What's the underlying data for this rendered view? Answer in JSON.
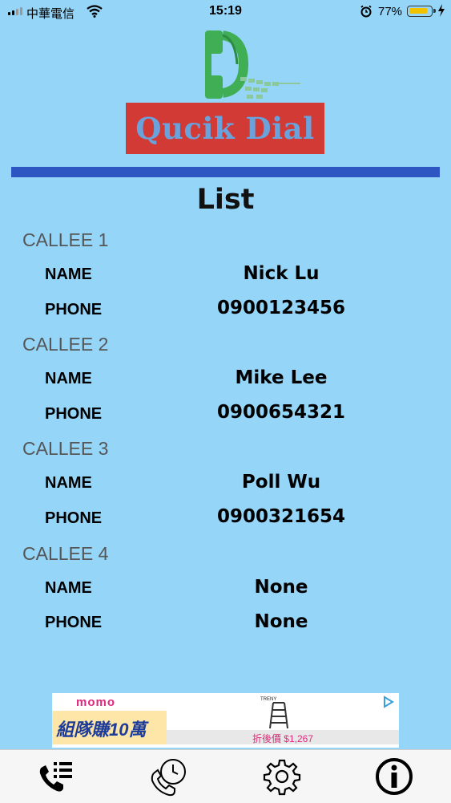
{
  "status_bar": {
    "carrier": "中華電信",
    "time": "15:19",
    "battery": "77%"
  },
  "app": {
    "title": "Qucik Dial",
    "list_title": "List"
  },
  "callees": [
    {
      "title": "CALLEE 1",
      "name_label": "NAME",
      "name": "Nick Lu",
      "phone_label": "PHONE",
      "phone": "0900123456"
    },
    {
      "title": "CALLEE 2",
      "name_label": "NAME",
      "name": "Mike Lee",
      "phone_label": "PHONE",
      "phone": "0900654321"
    },
    {
      "title": "CALLEE 3",
      "name_label": "NAME",
      "name": "Poll Wu",
      "phone_label": "PHONE",
      "phone": "0900321654"
    },
    {
      "title": "CALLEE 4",
      "name_label": "NAME",
      "name": "None",
      "phone_label": "PHONE",
      "phone": "None"
    }
  ],
  "ad": {
    "logo": "momo",
    "promo": "組隊賺10萬",
    "brand": "TRENY",
    "price": "折後價 $1,267"
  },
  "tabs": [
    {
      "icon": "phone-list-icon"
    },
    {
      "icon": "phone-clock-icon"
    },
    {
      "icon": "gear-icon"
    },
    {
      "icon": "info-icon"
    }
  ],
  "colors": {
    "background": "#95d5f8",
    "divider": "#2d56c2",
    "banner": "#d23a36",
    "logo_text": "#6aa2dc",
    "logo_green": "#3fae55"
  }
}
